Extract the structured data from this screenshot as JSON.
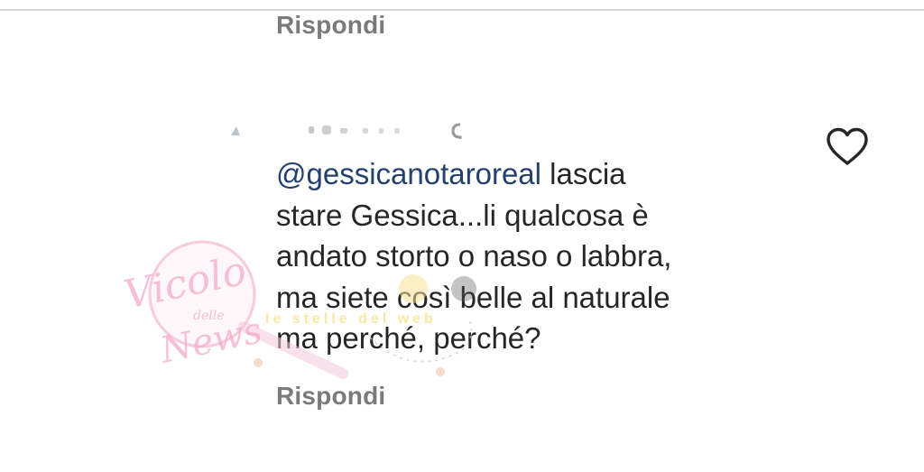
{
  "reply_top": "Rispondi",
  "comment": {
    "mention": "@gessicanotaroreal",
    "line1_rest": " lascia",
    "line2": "stare Gessica...li qualcosa è",
    "line3": "andato storto o naso o labbra,",
    "line4": "ma siete così belle al naturale",
    "line5": "ma perché,  perché?"
  },
  "reply_bottom": "Rispondi",
  "icons": {
    "like": "heart-outline-icon"
  },
  "watermark": {
    "brand_main": "Vicolo",
    "brand_small": "delle",
    "brand_end": "News",
    "tagline": "le stelle del web"
  },
  "colors": {
    "mention": "#23406e",
    "text": "#262626",
    "reply": "#7a7a7a",
    "watermark": "#f2a7c4",
    "tagline": "#f5d657"
  }
}
